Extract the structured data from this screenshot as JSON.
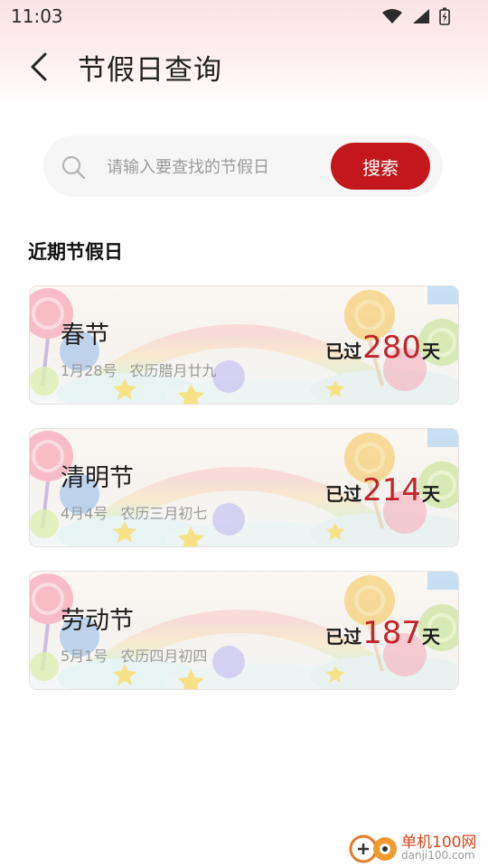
{
  "status_bar": {
    "time": "11:03",
    "icons": [
      "wifi-icon",
      "signal-icon",
      "battery-icon"
    ]
  },
  "header": {
    "title": "节假日查询",
    "back_icon": "chevron-left-icon"
  },
  "search": {
    "placeholder": "请输入要查找的节假日",
    "value": "",
    "button_label": "搜索",
    "icon": "search-icon"
  },
  "section": {
    "title": "近期节假日"
  },
  "holidays": [
    {
      "name": "春节",
      "date": "1月28号",
      "lunar": "农历腊月廿九",
      "passed_label": "已过",
      "days": "280",
      "unit": "天"
    },
    {
      "name": "清明节",
      "date": "4月4号",
      "lunar": "农历三月初七",
      "passed_label": "已过",
      "days": "214",
      "unit": "天"
    },
    {
      "name": "劳动节",
      "date": "5月1号",
      "lunar": "农历四月初四",
      "passed_label": "已过",
      "days": "187",
      "unit": "天"
    }
  ],
  "watermark": {
    "line1": "单机100网",
    "line2": "danji100.com"
  },
  "colors": {
    "accent": "#c3171d",
    "days_number": "#c0252a",
    "header_bg": "#fbe3e4",
    "search_bg": "#f6f6f6"
  }
}
